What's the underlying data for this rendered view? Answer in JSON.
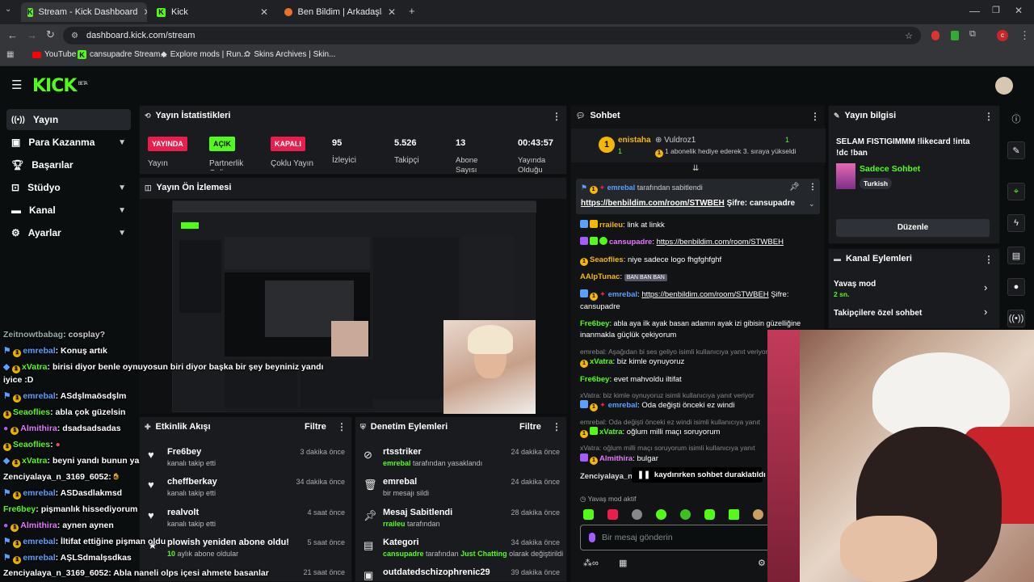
{
  "browser": {
    "tabs": [
      {
        "label": "Stream - Kick Dashboard"
      },
      {
        "label": "Kick"
      },
      {
        "label": "Ben Bildim | Arkadaşlarınla Onl"
      }
    ],
    "url": "dashboard.kick.com/stream",
    "bookmarks": [
      {
        "label": "YouTube"
      },
      {
        "label": "cansupadre Stream..."
      },
      {
        "label": "Explore mods | Run..."
      },
      {
        "label": "Skins Archives | Skin..."
      }
    ],
    "profile_initial": "c"
  },
  "kick": {
    "logo": "KICK",
    "logo_sup": "BETA"
  },
  "sidebar": {
    "items": [
      {
        "label": "Yayın",
        "icon": "broadcast-icon"
      },
      {
        "label": "Para Kazanma",
        "icon": "wallet-icon"
      },
      {
        "label": "Başarılar",
        "icon": "trophy-icon"
      },
      {
        "label": "Stüdyo",
        "icon": "studio-icon"
      },
      {
        "label": "Kanal",
        "icon": "channel-icon"
      },
      {
        "label": "Ayarlar",
        "icon": "gear-icon"
      }
    ]
  },
  "stats": {
    "title": "Yayın İstatistikleri",
    "items": [
      {
        "badge": "YAYINDA",
        "label": "Yayın"
      },
      {
        "badge": "AÇIK",
        "label": "Partnerlik Gelir"
      },
      {
        "badge": "KAPALI",
        "label": "Çoklu Yayın"
      },
      {
        "value": "95",
        "label": "İzleyici"
      },
      {
        "value": "5.526",
        "label": "Takipçi"
      },
      {
        "value": "13",
        "label": "Abone Sayısı"
      },
      {
        "value": "00:43:57",
        "label": "Yayında Olduğu"
      }
    ]
  },
  "preview": {
    "title": "Yayın Ön İzlemesi"
  },
  "activity": {
    "title": "Etkinlik Akışı",
    "filter": "Filtre",
    "rows": [
      {
        "name": "Fre6bey",
        "sub": "kanalı takip etti",
        "time": "3 dakika önce"
      },
      {
        "name": "cheffberkay",
        "sub": "kanalı takip etti",
        "time": "34 dakika önce"
      },
      {
        "name": "realvolt",
        "sub": "kanalı takip etti",
        "time": "4 saat önce"
      },
      {
        "name": "plowish yeniden abone oldu!",
        "sub_num": "10",
        "sub": "aylık abone oldular",
        "time": "5 saat önce"
      },
      {
        "name": "",
        "sub": "",
        "time": "21 saat önce"
      }
    ]
  },
  "moderation": {
    "title": "Denetim Eylemleri",
    "filter": "Filtre",
    "rows": [
      {
        "name": "rtsstriker",
        "by": "emrebal",
        "sub": "tarafından yasaklandı",
        "time": "24 dakika önce"
      },
      {
        "name": "emrebal",
        "by": "",
        "sub": "bir mesajı sildi",
        "time": "24 dakika önce"
      },
      {
        "name": "Mesaj Sabitlendi",
        "by": "rraileu",
        "sub": "tarafından",
        "time": "28 dakika önce"
      },
      {
        "name": "Kategori",
        "by": "cansupadre",
        "sub": "tarafından",
        "cat": "Just Chatting",
        "sub2": "olarak değiştirildi",
        "time": "34 dakika önce"
      },
      {
        "name": "outdatedschizophrenic29",
        "by": "",
        "sub": "",
        "time": "39 dakika önce"
      }
    ]
  },
  "chat": {
    "title": "Sohbet",
    "top_gifter": {
      "rank": "1",
      "name": "enistaha",
      "count": "1"
    },
    "top_gifter2": {
      "name": "Vuldroz1",
      "count": "1",
      "note": "1 abonelik hediye ederek 3. sıraya yükseldi"
    },
    "pinned": {
      "by_user": "emrebal",
      "by_text": "tarafından sabitlendi",
      "link": "https://benbildim.com/room/STWBEH",
      "after": "Şifre: cansupadre"
    },
    "messages": [
      {
        "user": "rraileu",
        "text": ": link at linkk"
      },
      {
        "user": "cansupadre",
        "text": ": ",
        "link": "https://benbildim.com/room/STWBEH"
      },
      {
        "user": "Seaoflies",
        "text": ": niye sadece logo fhgfghfghf"
      },
      {
        "user": "AAlpTunac",
        "text": ":",
        "emotes": "BAN BAN BAN"
      },
      {
        "user": "emrebal",
        "text": ": ",
        "link": "https://benbildim.com/room/STWBEH",
        "after": " Şifre:",
        "cont": "cansupadre"
      },
      {
        "user": "Fre6bey",
        "text": ": abla aya ilk ayak basan adamın ayak izi gibisin güzelliğine",
        "cont": "inanmakla güçlük çekiyorum"
      },
      {
        "sys": "emrebal: Aşağıdan bi ses geliyo isimli kullanıcıya yanıt veriyor"
      },
      {
        "user": "xVatra",
        "text": ": biz kimle oynuyoruz"
      },
      {
        "user": "Fre6bey",
        "text": ": evet mahvoldu iltifat"
      },
      {
        "sys": "xVatra: biz kimle oynuyoruz isimli kullanıcıya yanıt veriyor"
      },
      {
        "user": "emrebal",
        "text": ": Oda değişti önceki ez windi"
      },
      {
        "sys": "emrebal: Oda değişti önceki ez windi isimli kullanıcıya yanıt"
      },
      {
        "user": "xVatra",
        "text": ": oğlum milli maçı soruyorum"
      },
      {
        "sys": "xVatra: oğlum milli maçı soruyorum isimli kullanıcıya yanıt"
      },
      {
        "user": "Almithira",
        "text": ": bulgar"
      },
      {
        "user": "Zenciyalaya_n",
        "text": ""
      }
    ],
    "paused": "kaydırırken sohbet duraklatıldı",
    "slow_mode": "Yavaş mod aktif",
    "input_placeholder": "Bir mesaj gönderin"
  },
  "stream_info": {
    "title": "Yayın bilgisi",
    "stream_title": "SELAM FISTIGIMMM !likecard !inta !dc !ban",
    "category": "Sadece Sohbet",
    "tag": "Turkish",
    "edit": "Düzenle"
  },
  "channel_actions": {
    "title": "Kanal Eylemleri",
    "items": [
      {
        "label": "Yavaş mod",
        "sub": "2 sn."
      },
      {
        "label": "Takipçilere özel sohbet",
        "sub": ""
      }
    ]
  },
  "overlay_chat": [
    {
      "user": "Zeitnowtbabag",
      "text": ": cosplay?",
      "color": "#9aa"
    },
    {
      "user": "emrebal",
      "text": ": Konuş artık",
      "color": "#5aa0ff"
    },
    {
      "user": "xVatra",
      "text": ": birisi diyor benle oynuyosun biri diyor başka bir şey beyniniz yandı",
      "color": "#53fc18"
    },
    {
      "user": "",
      "text": "iyice :D",
      "color": "#fff"
    },
    {
      "user": "emrebal",
      "text": ": ASdşlmaösdşlm",
      "color": "#5aa0ff"
    },
    {
      "user": "Seaoflies",
      "text": ": abla çok güzelsin",
      "color": "#53fc18"
    },
    {
      "user": "Almithira",
      "text": ": dsadsadsadas",
      "color": "#e377ff"
    },
    {
      "user": "Seaoflies",
      "text": ":",
      "color": "#53fc18"
    },
    {
      "user": "xVatra",
      "text": ": beyni yandı bunun ya",
      "color": "#53fc18"
    },
    {
      "user": "Zenciyalaya_n_3169_6052",
      "text": ":",
      "color": "#fff"
    },
    {
      "user": "emrebal",
      "text": ": ASDasdlakmsd",
      "color": "#5aa0ff"
    },
    {
      "user": "Fre6bey",
      "text": ": pişmanlık hissediyorum",
      "color": "#53fc18"
    },
    {
      "user": "Almithira",
      "text": ": aynen aynen",
      "color": "#e377ff"
    },
    {
      "user": "emrebal",
      "text": ": İltifat ettiğine pişman oldu",
      "color": "#5aa0ff"
    },
    {
      "user": "emrebal",
      "text": ": AŞLSdmalşsdkas",
      "color": "#5aa0ff"
    },
    {
      "user": "Zenciyalaya_n_3169_6052",
      "text": ": Abla naneli olps içesi ahmete basanlar",
      "color": "#fff"
    }
  ],
  "colors": {
    "accent": "#53fc18",
    "live": "#e91e4c",
    "bg": "#0b0e0f",
    "panel": "#191b1f"
  }
}
